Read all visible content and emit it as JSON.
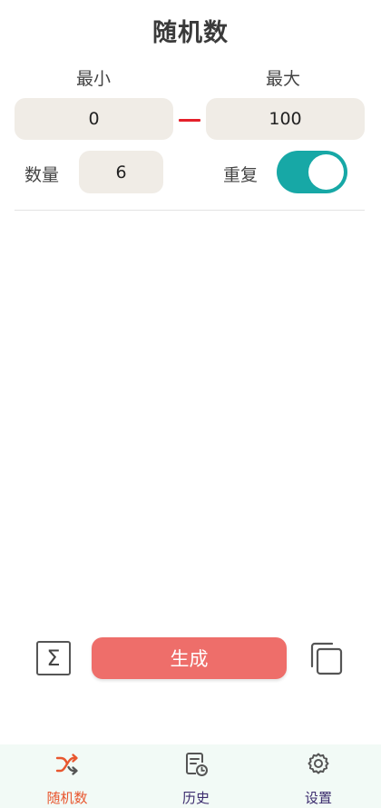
{
  "header": {
    "title": "随机数"
  },
  "range": {
    "min_label": "最小",
    "max_label": "最大",
    "min_value": "0",
    "max_value": "100"
  },
  "options": {
    "count_label": "数量",
    "count_value": "6",
    "repeat_label": "重复",
    "repeat_enabled": true
  },
  "actions": {
    "sum_icon": "sigma-icon",
    "generate_label": "生成",
    "copy_icon": "copy-icon"
  },
  "tabs": [
    {
      "label": "随机数",
      "icon": "shuffle-icon",
      "active": true
    },
    {
      "label": "历史",
      "icon": "history-icon",
      "active": false
    },
    {
      "label": "设置",
      "icon": "gear-icon",
      "active": false
    }
  ],
  "colors": {
    "accent": "#ee6e6a",
    "toggle_on": "#17a8a6",
    "active_tab": "#e8572f",
    "inactive_tab": "#3c2c6e",
    "field_bg": "#f0ece6",
    "dash": "#e4202a"
  }
}
